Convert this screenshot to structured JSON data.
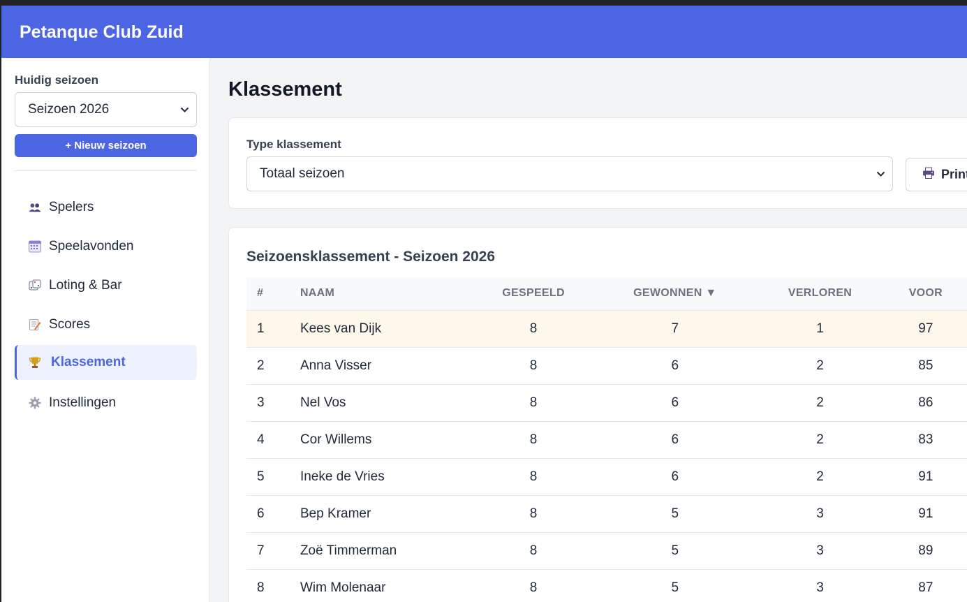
{
  "app": {
    "title": "Petanque Club Zuid"
  },
  "sidebar": {
    "season_label": "Huidig seizoen",
    "season_value": "Seizoen 2026",
    "new_season_label": "+ Nieuw seizoen",
    "items": [
      {
        "label": "Spelers",
        "icon": "people-icon"
      },
      {
        "label": "Speelavonden",
        "icon": "calendar-icon"
      },
      {
        "label": "Loting & Bar",
        "icon": "dice-icon"
      },
      {
        "label": "Scores",
        "icon": "memo-icon"
      },
      {
        "label": "Klassement",
        "icon": "trophy-icon",
        "active": true
      },
      {
        "label": "Instellingen",
        "icon": "gear-icon"
      }
    ]
  },
  "main": {
    "title": "Klassement",
    "filter": {
      "label": "Type klassement",
      "value": "Totaal seizoen"
    },
    "print_label": "Print",
    "table": {
      "title": "Seizoensklassement - Seizoen 2026",
      "headers": [
        "#",
        "NAAM",
        "GESPEELD",
        "GEWONNEN ▼",
        "VERLOREN",
        "VOOR"
      ],
      "rows": [
        [
          "1",
          "Kees van Dijk",
          "8",
          "7",
          "1",
          "97"
        ],
        [
          "2",
          "Anna Visser",
          "8",
          "6",
          "2",
          "85"
        ],
        [
          "3",
          "Nel Vos",
          "8",
          "6",
          "2",
          "86"
        ],
        [
          "4",
          "Cor Willems",
          "8",
          "6",
          "2",
          "83"
        ],
        [
          "5",
          "Ineke de Vries",
          "8",
          "6",
          "2",
          "91"
        ],
        [
          "6",
          "Bep Kramer",
          "8",
          "5",
          "3",
          "91"
        ],
        [
          "7",
          "Zoë Timmerman",
          "8",
          "5",
          "3",
          "89"
        ],
        [
          "8",
          "Wim Molenaar",
          "8",
          "5",
          "3",
          "87"
        ]
      ]
    }
  },
  "colors": {
    "brand": "#4b65e3",
    "highlight_row": "#fef7ec"
  }
}
